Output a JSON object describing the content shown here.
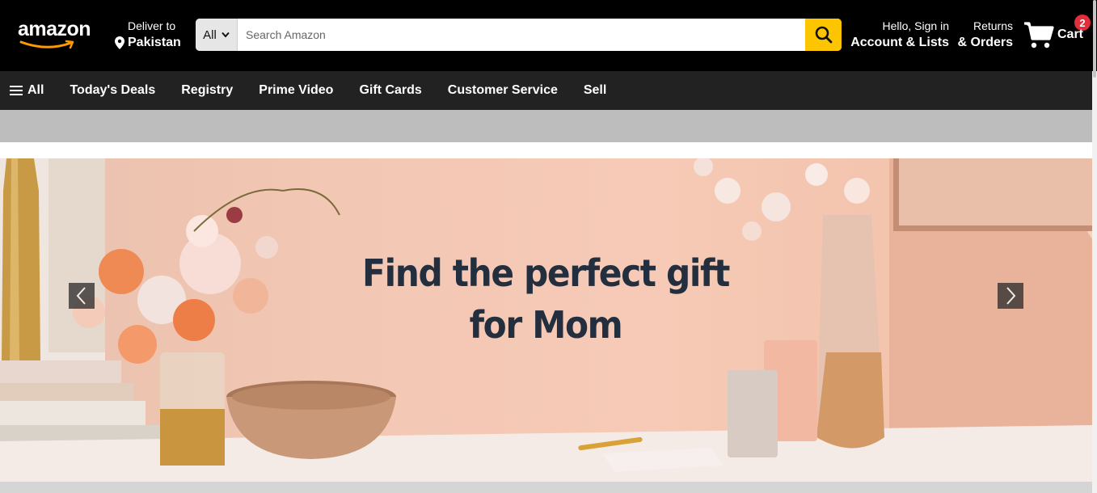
{
  "header": {
    "logo_text": "amazon",
    "deliver_small": "Deliver to",
    "deliver_big": "Pakistan",
    "search": {
      "category": "All",
      "placeholder": "Search Amazon"
    },
    "account_small": "Hello, Sign in",
    "account_big": "Account & Lists",
    "returns_small": "Returns",
    "returns_big": "& Orders",
    "cart_count": "2",
    "cart_label": "Cart"
  },
  "nav": {
    "all_label": "All",
    "items": [
      "Today's Deals",
      "Registry",
      "Prime Video",
      "Gift Cards",
      "Customer Service",
      "Sell"
    ]
  },
  "hero": {
    "title_line1": "Find the perfect gift",
    "title_line2": "for Mom"
  },
  "colors": {
    "header_bg": "#000000",
    "nav_bg": "#222222",
    "search_button": "#fcc500",
    "cart_badge": "#e12e3b",
    "hero_text": "#232f3e"
  }
}
